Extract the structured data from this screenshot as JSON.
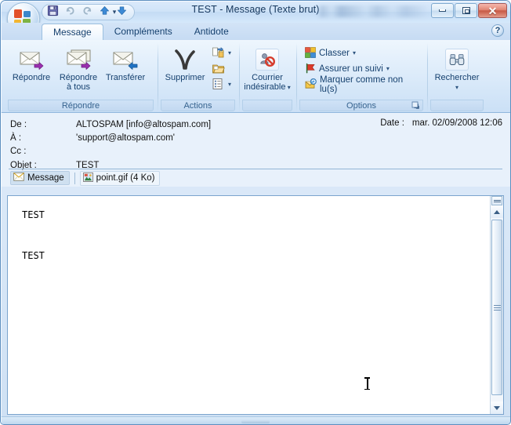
{
  "window": {
    "title": "TEST  - Message (Texte brut)",
    "minimize_label": "Réduire",
    "maximize_label": "Agrandir",
    "close_label": "Fermer",
    "close_glyph": "✕"
  },
  "orb": {
    "name": "Bouton Office",
    "colors": {
      "red": "#e2502a",
      "green": "#7db343",
      "blue": "#3b87c9",
      "yellow": "#f2b632"
    }
  },
  "quick_access": {
    "items": [
      {
        "name": "save",
        "label": "Enregistrer",
        "icon": "save-icon"
      },
      {
        "name": "undo",
        "label": "Annuler",
        "icon": "undo-icon"
      },
      {
        "name": "redo",
        "label": "Rétablir",
        "icon": "redo-icon"
      },
      {
        "name": "previous",
        "label": "Élément précédent",
        "icon": "arrow-up-icon"
      },
      {
        "name": "next",
        "label": "Élément suivant",
        "icon": "arrow-down-icon"
      }
    ],
    "more_label": "Personnaliser la barre d'outils Accès rapide",
    "more_glyph": "▾"
  },
  "tabs": [
    {
      "label": "Message",
      "active": true
    },
    {
      "label": "Compléments",
      "active": false
    },
    {
      "label": "Antidote",
      "active": false
    }
  ],
  "help": {
    "glyph": "?",
    "label": "Aide"
  },
  "ribbon": {
    "groups": [
      {
        "name": "repondre",
        "label": "Répondre",
        "buttons": [
          {
            "label": "Répondre",
            "icon": "reply-icon"
          },
          {
            "label": "Répondre\nà tous",
            "line1": "Répondre",
            "line2": "à tous",
            "icon": "reply-all-icon"
          },
          {
            "label": "Transférer",
            "icon": "forward-icon"
          }
        ]
      },
      {
        "name": "actions",
        "label": "Actions",
        "buttons": [
          {
            "label": "Supprimer",
            "icon": "delete-x-icon"
          }
        ],
        "small_buttons": [
          {
            "label": "Déplacer vers un dossier",
            "icon": "move-to-folder-icon",
            "has_caret": true
          },
          {
            "label": "Autres actions",
            "icon": "open-folder-icon",
            "has_caret": false
          },
          {
            "label": "Autres actions",
            "icon": "other-actions-icon",
            "has_caret": true
          }
        ]
      },
      {
        "name": "courrier-indesirable",
        "label": "",
        "buttons": [
          {
            "line1": "Courrier",
            "line2": "indésirable",
            "icon": "junk-mail-icon",
            "has_caret": true
          }
        ]
      },
      {
        "name": "options",
        "label": "Options",
        "dialog_launcher": true,
        "rows": [
          {
            "label": "Classer",
            "icon": "categorize-icon",
            "has_caret": true
          },
          {
            "label": "Assurer un suivi",
            "icon": "flag-icon",
            "has_caret": true
          },
          {
            "label": "Marquer comme non lu(s)",
            "icon": "mark-unread-icon",
            "has_caret": false
          }
        ]
      },
      {
        "name": "rechercher",
        "label": "",
        "buttons": [
          {
            "label": "Rechercher",
            "icon": "binoculars-icon",
            "has_caret": true
          }
        ]
      }
    ]
  },
  "message_header": {
    "from_label": "De :",
    "from_value": "ALTOSPAM [info@altospam.com]",
    "to_label": "À :",
    "to_value": "'support@altospam.com'",
    "cc_label": "Cc :",
    "cc_value": "",
    "subject_label": "Objet :",
    "subject_value": "TEST",
    "date_label": "Date :",
    "date_value": "mar. 02/09/2008 12:06"
  },
  "attachments": {
    "message_tab_label": "Message",
    "message_tab_icon": "envelope-icon",
    "files": [
      {
        "name": "point.gif (4 Ko)",
        "icon": "image-file-icon"
      }
    ]
  },
  "body": {
    "line1": "TEST",
    "line2": "TEST"
  },
  "scrollbar": {
    "split_label": "Fractionner",
    "up_label": "Haut",
    "down_label": "Bas",
    "thumb_label": "Curseur de défilement"
  }
}
